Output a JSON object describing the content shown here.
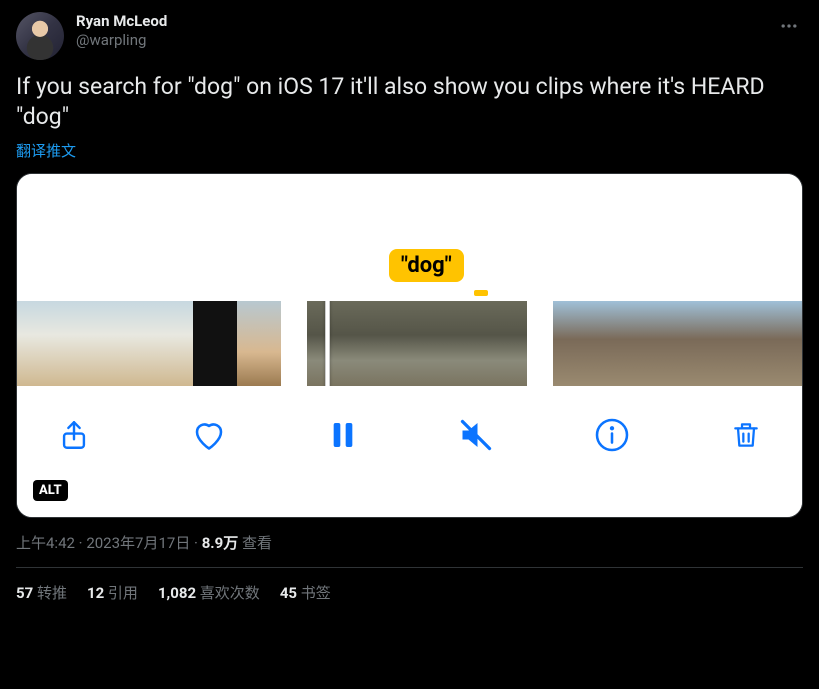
{
  "author": {
    "display_name": "Ryan McLeod",
    "handle": "@warpling"
  },
  "tweet_text": "If you search for \"dog\" on iOS 17 it'll also show you clips where it's HEARD \"dog\"",
  "translate_label": "翻译推文",
  "media": {
    "label_text": "\"dog\"",
    "alt_badge": "ALT"
  },
  "meta": {
    "time": "上午4:42",
    "date": "2023年7月17日",
    "views_count": "8.9万",
    "views_label": "查看",
    "separator": " · "
  },
  "stats": {
    "retweets": {
      "count": "57",
      "label": "转推"
    },
    "quotes": {
      "count": "12",
      "label": "引用"
    },
    "likes": {
      "count": "1,082",
      "label": "喜欢次数"
    },
    "bookmarks": {
      "count": "45",
      "label": "书签"
    }
  }
}
